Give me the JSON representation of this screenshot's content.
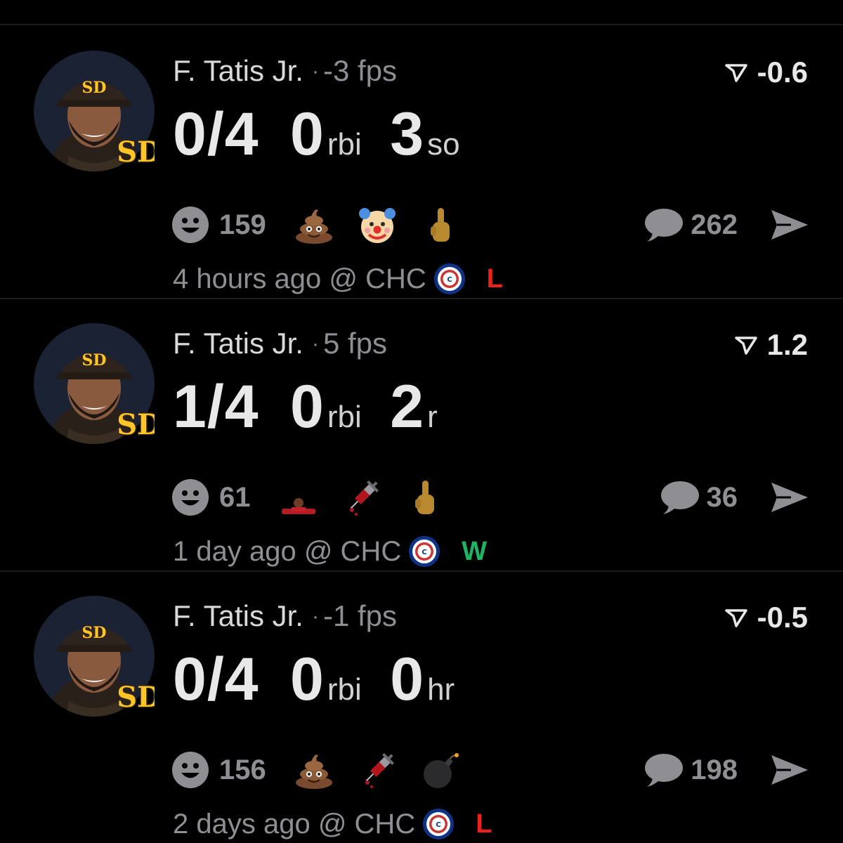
{
  "colors": {
    "background": "#000000",
    "win": "#1fb463",
    "loss": "#e8231c",
    "muted": "#8e8e93",
    "padres_gold": "#ffc425",
    "padres_brown": "#2f241d",
    "cubs_blue": "#0e3386",
    "cubs_red": "#cc3433"
  },
  "feed": [
    {
      "player": "F. Tatis Jr.",
      "dot": "·",
      "fps": "-3 fps",
      "score": "-0.6",
      "stats": [
        {
          "value": "0/4",
          "unit": ""
        },
        {
          "value": "0",
          "unit": "rbi"
        },
        {
          "value": "3",
          "unit": "so"
        }
      ],
      "reaction_count": "159",
      "reaction_emojis": [
        "poop-emoji",
        "clown-emoji",
        "middle-finger-emoji"
      ],
      "comment_count": "262",
      "time": "4 hours ago",
      "opponent": "@ CHC",
      "result": "L"
    },
    {
      "player": "F. Tatis Jr.",
      "dot": "·",
      "fps": "5 fps",
      "score": "1.2",
      "stats": [
        {
          "value": "1/4",
          "unit": ""
        },
        {
          "value": "0",
          "unit": "rbi"
        },
        {
          "value": "2",
          "unit": "r"
        }
      ],
      "reaction_count": "61",
      "reaction_emojis": [
        "player-sticker-emoji",
        "syringe-emoji",
        "middle-finger-emoji"
      ],
      "comment_count": "36",
      "time": "1 day ago",
      "opponent": "@ CHC",
      "result": "W"
    },
    {
      "player": "F. Tatis Jr.",
      "dot": "·",
      "fps": "-1 fps",
      "score": "-0.5",
      "stats": [
        {
          "value": "0/4",
          "unit": ""
        },
        {
          "value": "0",
          "unit": "rbi"
        },
        {
          "value": "0",
          "unit": "hr"
        }
      ],
      "reaction_count": "156",
      "reaction_emojis": [
        "poop-emoji",
        "syringe-emoji",
        "bomb-emoji"
      ],
      "comment_count": "198",
      "time": "2 days ago",
      "opponent": "@ CHC",
      "result": "L"
    }
  ]
}
